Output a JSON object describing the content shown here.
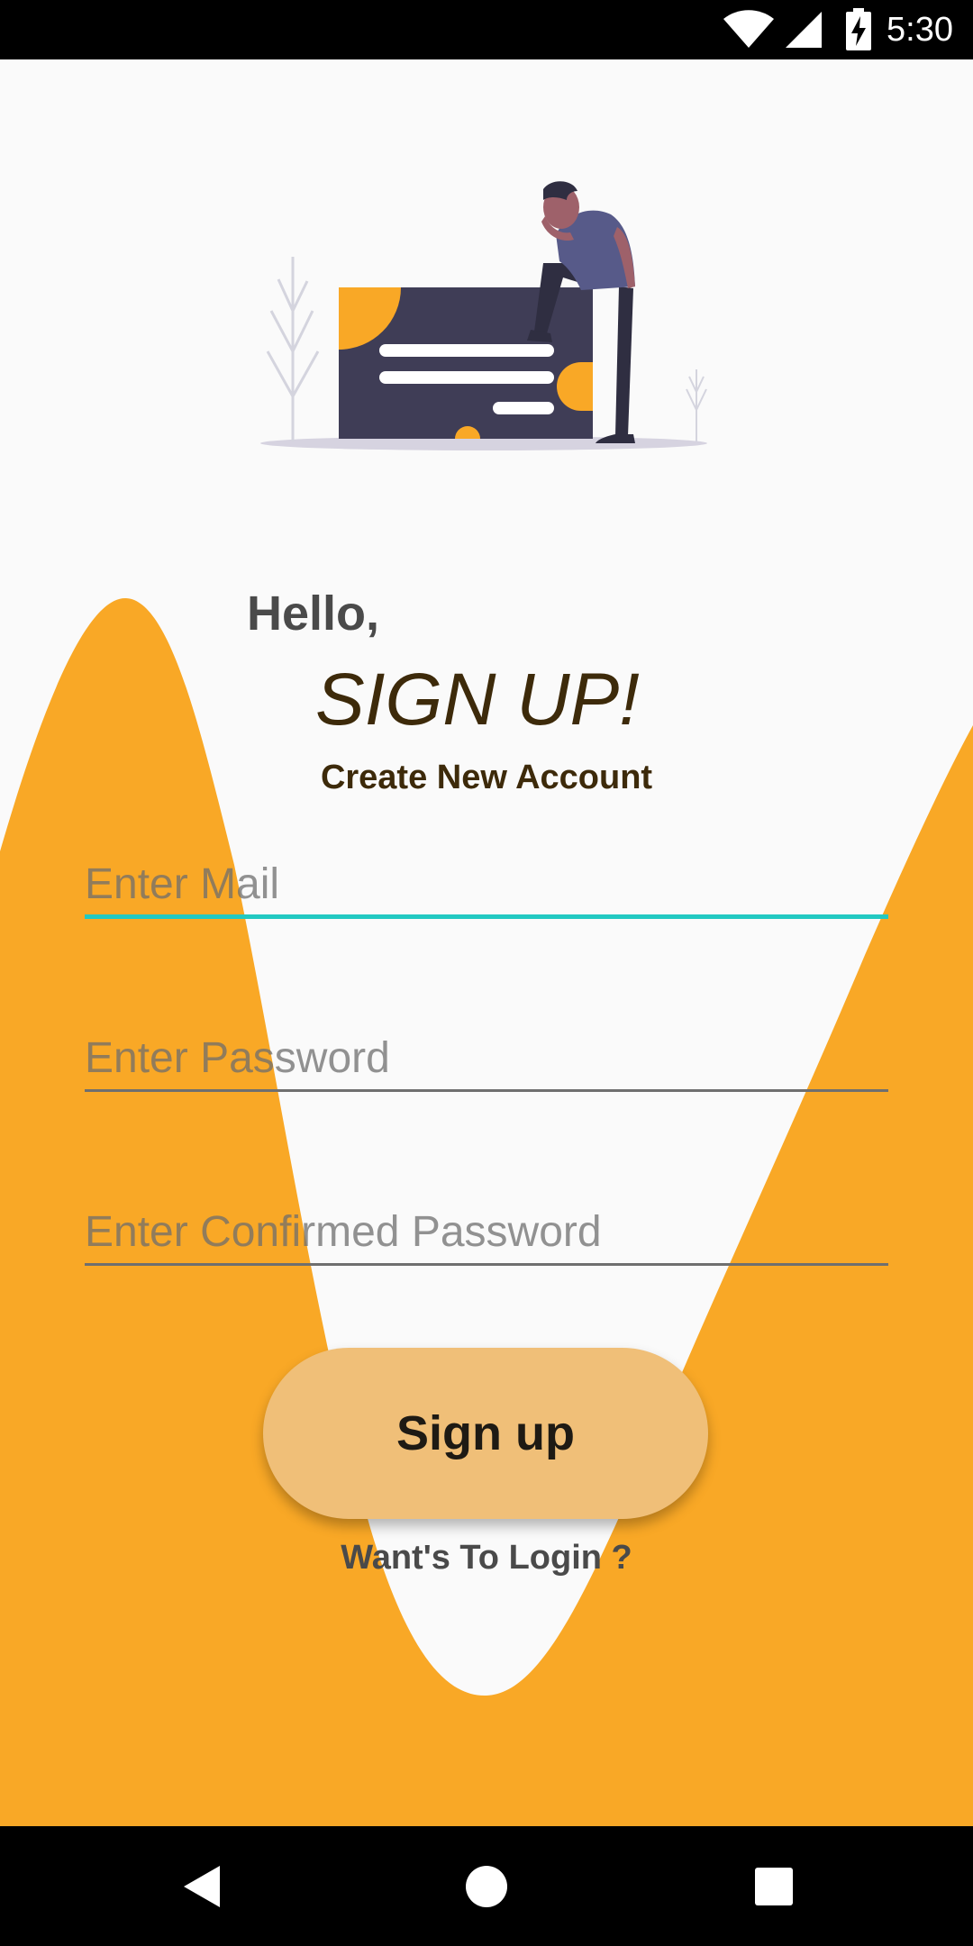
{
  "status_bar": {
    "time": "5:30"
  },
  "header": {
    "greeting": "Hello,",
    "title": "SIGN UP!",
    "subtitle": "Create New Account"
  },
  "form": {
    "email_placeholder": "Enter Mail",
    "password_placeholder": "Enter Password",
    "confirm_placeholder": "Enter Confirmed Password",
    "submit_label": "Sign up",
    "login_link": "Want's To Login ?"
  },
  "colors": {
    "accent": "#f9a826",
    "button": "#f0bf78",
    "focus_underline": "#22c9c2",
    "title_text": "#3d2a0a"
  },
  "icons": [
    "wifi-icon",
    "cell-signal-icon",
    "battery-charging-icon",
    "nav-back-icon",
    "nav-home-icon",
    "nav-recents-icon"
  ]
}
